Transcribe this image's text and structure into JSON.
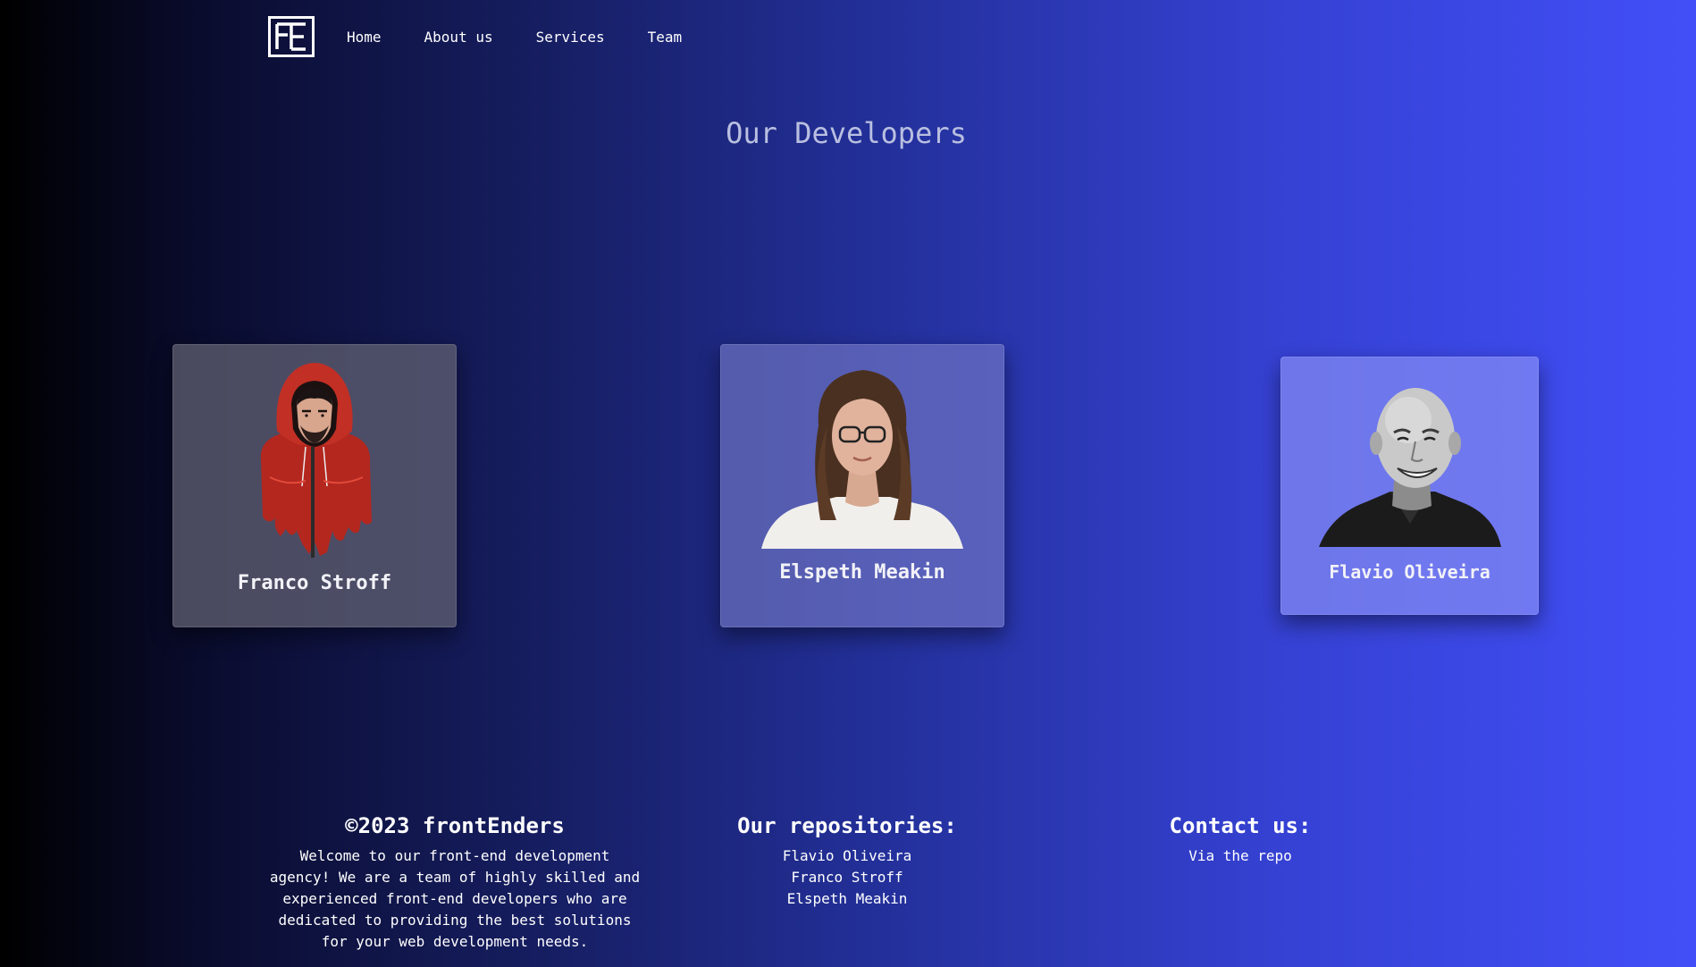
{
  "nav": {
    "logo_text": "FE",
    "links": [
      "Home",
      "About us",
      "Services",
      "Team"
    ]
  },
  "main": {
    "title": "Our Developers",
    "developers": [
      {
        "name": "Franco Stroff",
        "avatar_icon": "hooded-man-illustration"
      },
      {
        "name": "Elspeth Meakin",
        "avatar_icon": "woman-portrait-photo"
      },
      {
        "name": "Flavio Oliveira",
        "avatar_icon": "bald-man-portrait-photo"
      }
    ]
  },
  "footer": {
    "about": {
      "heading": "©2023 frontEnders",
      "lines": [
        "Welcome to our front-end development",
        "agency! We are a team of highly skilled and",
        "experienced front-end developers who are",
        "dedicated to providing the best solutions",
        "for your web development needs."
      ]
    },
    "repos": {
      "heading": "Our repositories:",
      "links": [
        "Flavio Oliveira",
        "Franco Stroff",
        "Elspeth Meakin"
      ]
    },
    "contact": {
      "heading": "Contact us:",
      "link": "Via the repo"
    }
  },
  "colors": {
    "gradient_start": "#000000",
    "gradient_end": "#424ff8",
    "title": "#b9bfe0"
  }
}
